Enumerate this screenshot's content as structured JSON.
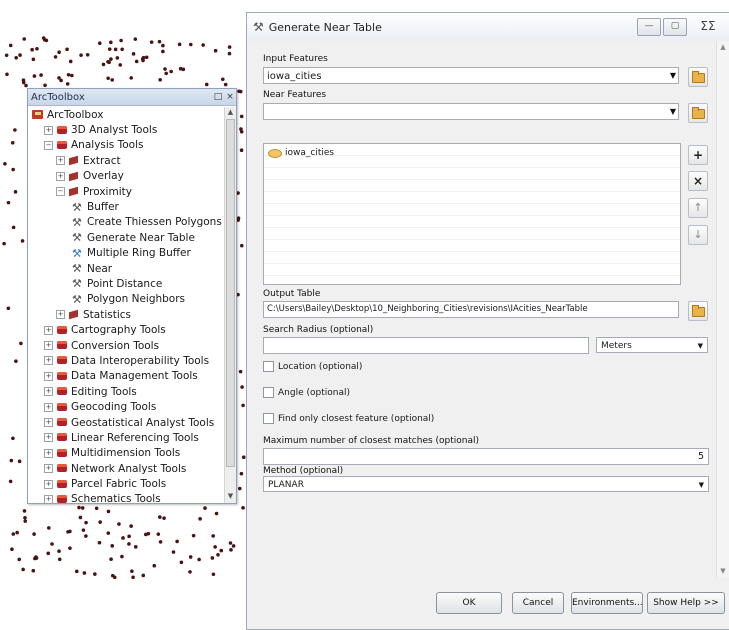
{
  "toolbox": {
    "title": "ArcToolbox",
    "title_controls": [
      "□",
      "×"
    ],
    "items": [
      {
        "label": "ArcToolbox",
        "icon": "root",
        "expander": "",
        "level": 0
      },
      {
        "label": "3D Analyst Tools",
        "icon": "box",
        "expander": "+",
        "level": 1
      },
      {
        "label": "Analysis Tools",
        "icon": "box",
        "expander": "−",
        "level": 1
      },
      {
        "label": "Extract",
        "icon": "set",
        "expander": "+",
        "level": 2
      },
      {
        "label": "Overlay",
        "icon": "set",
        "expander": "+",
        "level": 2
      },
      {
        "label": "Proximity",
        "icon": "set",
        "expander": "−",
        "level": 2
      },
      {
        "label": "Buffer",
        "icon": "hammer",
        "expander": "",
        "level": 3
      },
      {
        "label": "Create Thiessen Polygons",
        "icon": "hammer",
        "expander": "",
        "level": 3
      },
      {
        "label": "Generate Near Table",
        "icon": "hammer",
        "expander": "",
        "level": 3
      },
      {
        "label": "Multiple Ring Buffer",
        "icon": "ring",
        "expander": "",
        "level": 3
      },
      {
        "label": "Near",
        "icon": "hammer",
        "expander": "",
        "level": 3
      },
      {
        "label": "Point Distance",
        "icon": "hammer",
        "expander": "",
        "level": 3
      },
      {
        "label": "Polygon Neighbors",
        "icon": "hammer",
        "expander": "",
        "level": 3
      },
      {
        "label": "Statistics",
        "icon": "set",
        "expander": "+",
        "level": 2
      },
      {
        "label": "Cartography Tools",
        "icon": "box",
        "expander": "+",
        "level": 1
      },
      {
        "label": "Conversion Tools",
        "icon": "box",
        "expander": "+",
        "level": 1
      },
      {
        "label": "Data Interoperability Tools",
        "icon": "box",
        "expander": "+",
        "level": 1
      },
      {
        "label": "Data Management Tools",
        "icon": "box",
        "expander": "+",
        "level": 1
      },
      {
        "label": "Editing Tools",
        "icon": "box",
        "expander": "+",
        "level": 1
      },
      {
        "label": "Geocoding Tools",
        "icon": "box",
        "expander": "+",
        "level": 1
      },
      {
        "label": "Geostatistical Analyst Tools",
        "icon": "box",
        "expander": "+",
        "level": 1
      },
      {
        "label": "Linear Referencing Tools",
        "icon": "box",
        "expander": "+",
        "level": 1
      },
      {
        "label": "Multidimension Tools",
        "icon": "box",
        "expander": "+",
        "level": 1
      },
      {
        "label": "Network Analyst Tools",
        "icon": "box",
        "expander": "+",
        "level": 1
      },
      {
        "label": "Parcel Fabric Tools",
        "icon": "box",
        "expander": "+",
        "level": 1
      },
      {
        "label": "Schematics Tools",
        "icon": "box",
        "expander": "+",
        "level": 1
      }
    ]
  },
  "dialog": {
    "title": "Generate Near Table",
    "window_controls": {
      "minimize": "—",
      "restore": "▢",
      "close": "ΣΣ"
    },
    "input_features": {
      "label": "Input Features",
      "value": "iowa_cities"
    },
    "near_features": {
      "label": "Near Features",
      "value": "",
      "list": [
        "iowa_cities"
      ]
    },
    "output_table": {
      "label": "Output Table",
      "value": "C:\\Users\\Bailey\\Desktop\\10_Neighboring_Cities\\revisions\\IAcities_NearTable"
    },
    "search_radius": {
      "label": "Search Radius (optional)",
      "value": "",
      "unit": "Meters"
    },
    "location": {
      "label": "Location (optional)"
    },
    "angle": {
      "label": "Angle (optional)"
    },
    "closest": {
      "label": "Find only closest feature (optional)"
    },
    "max_matches": {
      "label": "Maximum number of closest matches (optional)",
      "value": "5"
    },
    "method": {
      "label": "Method (optional)",
      "value": "PLANAR"
    },
    "side_buttons": {
      "add": "+",
      "remove": "×",
      "up": "↑",
      "down": "↓"
    },
    "buttons": {
      "ok": "OK",
      "cancel": "Cancel",
      "environments": "Environments...",
      "help": "Show Help >>"
    }
  },
  "colors": {
    "map_points": "#4a1414",
    "accent": "#b3202a"
  }
}
